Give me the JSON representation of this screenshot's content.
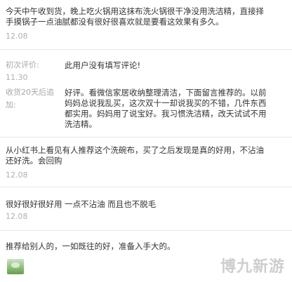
{
  "reviews": [
    {
      "text_lines": [
        "今天中午收到货，晚上吃火锅用这抹布洗火锅很干净没用洗洁精，直接择",
        "手摸锅子一点油腻都没有很好很喜欢就是要看这效果有多久。"
      ],
      "date": "12.08"
    },
    {
      "first_label": "初次评价:",
      "first_text": "此用户没有填写评论!",
      "first_time": "11.30",
      "followup_label_lines": [
        "收货20天后追",
        "加:"
      ],
      "followup_text_lines": [
        "好评。看微信家居收纳整理清洁，下面留言推荐的。以前",
        "妈妈总说我乱买，这次双十一却说我买的不错，几件东西",
        "都实用。妈妈用了说宝好。我习惯洗洁精，改天试试不用",
        "洗洁精。"
      ]
    },
    {
      "text_lines": [
        "从小红书上看见有人推荐这个洗碗布，买了之后发现是真的好用，不沾油",
        "还好洗。会回购"
      ],
      "date": "12.08"
    },
    {
      "text_lines": [
        "很好很好很好用 一点不沾油 而且也不脱毛"
      ],
      "date": "12.08"
    },
    {
      "text_lines": [
        "推荐给别人的，一如既往的好，准备入手大的。"
      ]
    }
  ],
  "watermark": "博九新游"
}
